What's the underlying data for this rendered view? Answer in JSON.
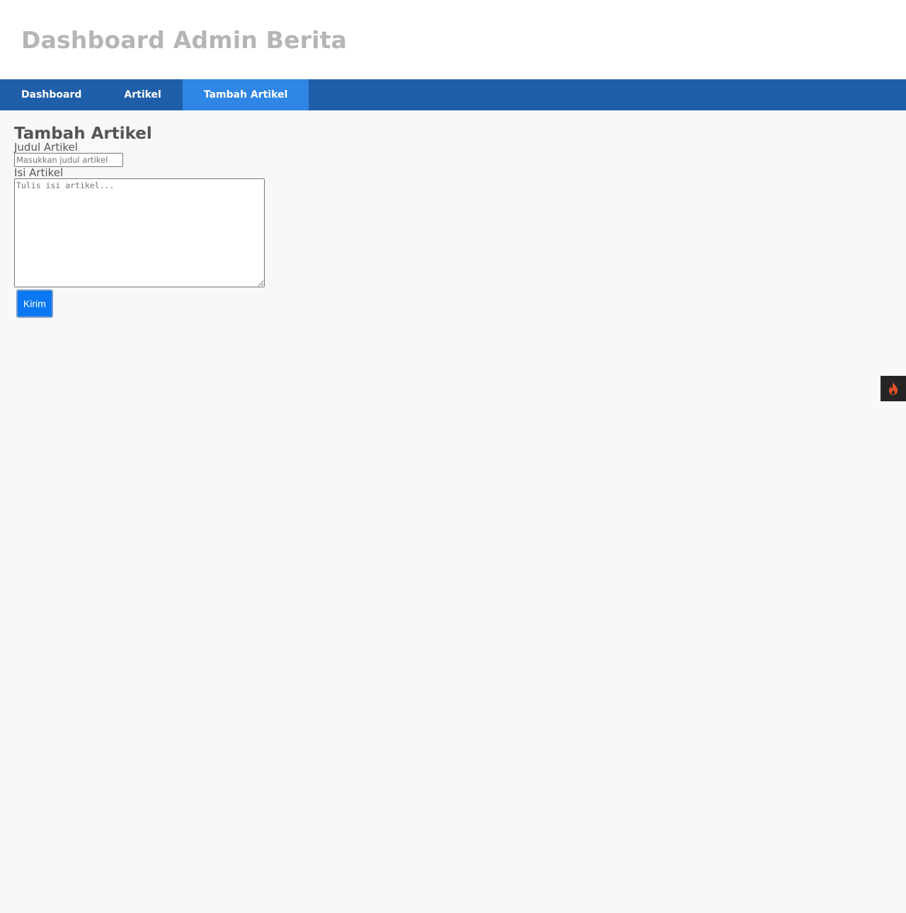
{
  "header": {
    "title": "Dashboard Admin Berita"
  },
  "nav": {
    "items": [
      {
        "label": "Dashboard",
        "active": false
      },
      {
        "label": "Artikel",
        "active": false
      },
      {
        "label": "Tambah Artikel",
        "active": true
      }
    ]
  },
  "form": {
    "heading": "Tambah Artikel",
    "title_label": "Judul Artikel",
    "title_value": "",
    "title_placeholder": "Masukkan judul artikel",
    "content_label": "Isi Artikel",
    "content_value": "",
    "content_placeholder": "Tulis isi artikel...",
    "submit_label": "Kirim"
  },
  "debug_toolbar": {
    "icon": "flame-icon"
  },
  "colors": {
    "nav_background": "#1f5fa9",
    "nav_active": "#2f86e5",
    "button_primary": "#0a78f3",
    "page_background": "#f8f8f8",
    "flame": "#e8532a"
  }
}
